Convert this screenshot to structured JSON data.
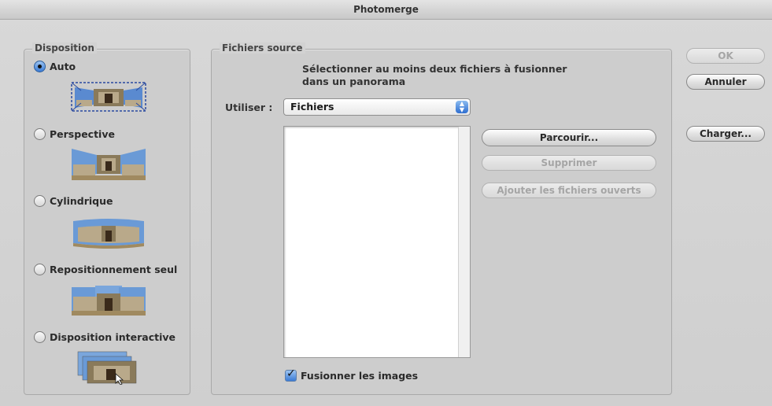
{
  "window": {
    "title": "Photomerge"
  },
  "layout_group": {
    "label": "Disposition",
    "options": [
      {
        "label": "Auto",
        "selected": true,
        "icon": "panorama-auto-icon"
      },
      {
        "label": "Perspective",
        "selected": false,
        "icon": "panorama-perspective-icon"
      },
      {
        "label": "Cylindrique",
        "selected": false,
        "icon": "panorama-cylindrical-icon"
      },
      {
        "label": "Repositionnement seul",
        "selected": false,
        "icon": "panorama-reposition-icon"
      },
      {
        "label": "Disposition interactive",
        "selected": false,
        "icon": "panorama-interactive-icon"
      }
    ]
  },
  "source_group": {
    "label": "Fichiers source",
    "instruction_line1": "Sélectionner au moins deux fichiers à fusionner",
    "instruction_line2": "dans un panorama",
    "use_label": "Utiliser :",
    "use_value": "Fichiers",
    "browse_label": "Parcourir...",
    "remove_label": "Supprimer",
    "add_open_label": "Ajouter les fichiers ouverts",
    "blend_label": "Fusionner les images",
    "blend_checked": true
  },
  "dialog_buttons": {
    "ok_label": "OK",
    "cancel_label": "Annuler",
    "load_label": "Charger..."
  }
}
